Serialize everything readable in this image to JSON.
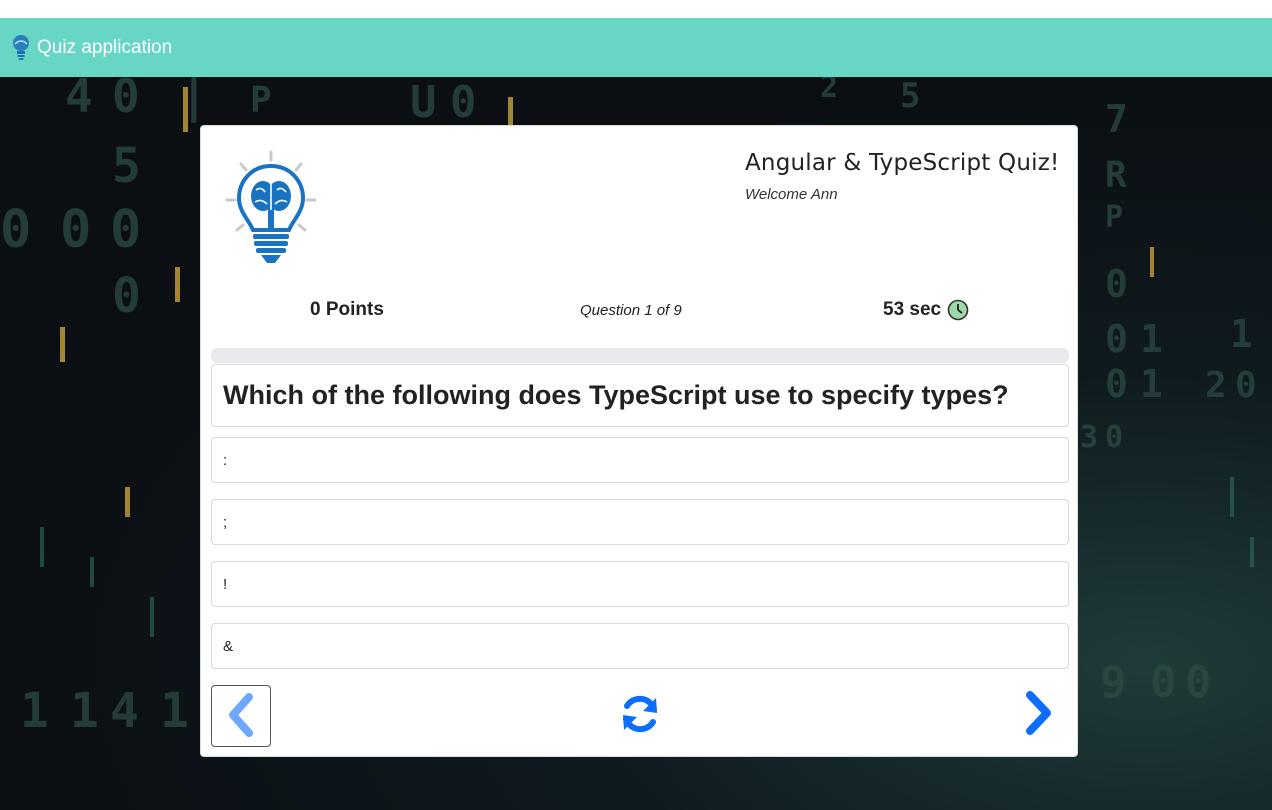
{
  "navbar": {
    "brand_label": "Quiz application",
    "brand_icon": "lightbulb-icon",
    "color": "#67d6c5"
  },
  "quiz": {
    "title": "Angular & TypeScript Quiz!",
    "welcome": "Welcome Ann",
    "logo_icon": "lightbulb-brain-icon",
    "points": "0 Points",
    "question_counter": "Question 1 of 9",
    "timer": "53 sec",
    "timer_icon": "clock-icon",
    "progress_fraction": 0,
    "question": "Which of the following does TypeScript use to specify types?",
    "answers": [
      ":",
      ";",
      "!",
      "&"
    ]
  },
  "controls": {
    "prev_icon": "chevron-left-icon",
    "restart_icon": "refresh-icon",
    "next_icon": "chevron-right-icon",
    "accent_color": "#0d6efd"
  }
}
